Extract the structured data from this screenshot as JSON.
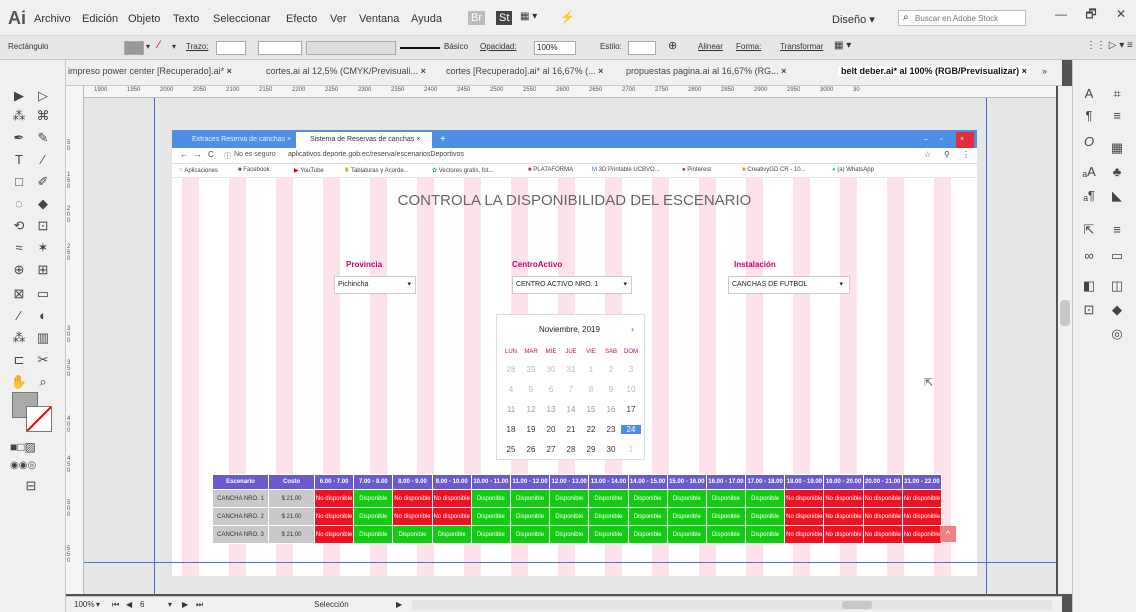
{
  "app": {
    "logo": "Ai"
  },
  "menu": [
    "Archivo",
    "Edición",
    "Objeto",
    "Texto",
    "Seleccionar",
    "Efecto",
    "Ver",
    "Ventana",
    "Ayuda"
  ],
  "menu_badges": [
    "Br",
    "St"
  ],
  "workspace": "Diseño",
  "search_placeholder": "Buscar en Adobe Stock",
  "window_controls": [
    "—",
    "🗗",
    "✕"
  ],
  "control_bar": {
    "object": "Rectángulo",
    "stroke_label": "Trazo:",
    "brush": "Básico",
    "opacity_label": "Opacidad:",
    "opacity": "100%",
    "style_label": "Estilo:",
    "align": "Alinear",
    "shape": "Forma:",
    "transform": "Transformar"
  },
  "doc_tabs": [
    {
      "label": "impreso power center [Recuperado].ai*",
      "close": "×"
    },
    {
      "label": "cortes.ai al 12,5% (CMYK/Previsuali...",
      "close": "×"
    },
    {
      "label": "cortes [Recuperado].ai* al 16,67% (...",
      "close": "×"
    },
    {
      "label": "propuestas pagina.ai al 16,67% (RG...",
      "close": "×"
    },
    {
      "label": "belt deber.ai* al 100% (RGB/Previsualizar)",
      "close": "×"
    }
  ],
  "tabs_more": "»",
  "ruler_top": [
    "1900",
    "1950",
    "2000",
    "2050",
    "2100",
    "2150",
    "2200",
    "2250",
    "2300",
    "2350",
    "2400",
    "2450",
    "2500",
    "2550",
    "2600",
    "2650",
    "2700",
    "2750",
    "2800",
    "2850",
    "2900",
    "2950",
    "3000",
    "30"
  ],
  "ruler_left": [
    "5",
    "0",
    "1",
    "5",
    "0",
    "2",
    "0",
    "0",
    "2",
    "5",
    "0",
    "3",
    "0",
    "0",
    "3",
    "5",
    "0",
    "4",
    "0",
    "0",
    "4",
    "5",
    "0",
    "5",
    "0",
    "0",
    "5",
    "5",
    "0"
  ],
  "status": {
    "zoom": "100%",
    "page": "6",
    "tool": "Selección"
  },
  "browser": {
    "tabs": [
      {
        "label": "Extraces Reserva de canchas",
        "close": "×"
      },
      {
        "label": "Sistema de Reservas de canchas",
        "close": "×"
      }
    ],
    "new_tab": "+",
    "nav": [
      "←",
      "→",
      "C"
    ],
    "secure": "No es seguro",
    "url": "aplicativos.deporte.gob.ec/reserva/escenariosDeportivos",
    "bookmarks": [
      "Aplicaciones",
      "Facebook",
      "YouTube",
      "Tablaturas y Acorde...",
      "Vectores gratis, fot...",
      "PLATAFORMA",
      "3D Printable UCBVO...",
      "Pinterest",
      "CreativyGD CR - 10...",
      "(a) WhatsApp"
    ]
  },
  "page": {
    "title": "CONTROLA LA DISPONIBILIDAD DEL ESCENARIO",
    "filters": [
      {
        "label": "Provincia",
        "value": "Pichincha"
      },
      {
        "label": "CentroActivo",
        "value": "CENTRO ACTIVO NRO. 1"
      },
      {
        "label": "Instalación",
        "value": "CANCHAS DE FUTBOL"
      }
    ],
    "calendar": {
      "month": "Noviembre, 2019",
      "weekdays": [
        "LUN",
        "MAR",
        "MIE",
        "JUE",
        "VIE",
        "SAB",
        "DOM"
      ],
      "weeks": [
        [
          "28",
          "29",
          "30",
          "31",
          "1",
          "2",
          "3"
        ],
        [
          "4",
          "5",
          "6",
          "7",
          "8",
          "9",
          "10"
        ],
        [
          "11",
          "12",
          "13",
          "14",
          "15",
          "16",
          "17"
        ],
        [
          "18",
          "19",
          "20",
          "21",
          "22",
          "23",
          "24"
        ],
        [
          "25",
          "26",
          "27",
          "28",
          "29",
          "30",
          "1"
        ]
      ],
      "selected": "24"
    },
    "table": {
      "headers": [
        "Escenario",
        "Costo",
        "6.00 - 7.00",
        "7.00 - 8.00",
        "8.00 - 9.00",
        "9.00 - 10.00",
        "10.00 - 11.00",
        "11.00 - 12.00",
        "12.00 - 13.00",
        "13.00 - 14.00",
        "14.00 - 15.00",
        "15.00 - 16.00",
        "16.00 - 17.00",
        "17.00 - 18.00",
        "18.00 - 19.00",
        "19.00 - 20.00",
        "20.00 - 21.00",
        "21.00 - 22.00"
      ],
      "rows": [
        {
          "name": "CANCHA NRO. 1",
          "cost": "$ 21,00",
          "status": [
            "No disponible",
            "Disponible",
            "No disponible",
            "No disponible",
            "Disponible",
            "Disponible",
            "Disponible",
            "Disponible",
            "Disponible",
            "Disponible",
            "Disponible",
            "Disponible",
            "No disponible",
            "No disponible",
            "No disponible",
            "No disponible"
          ]
        },
        {
          "name": "CANCHA NRO. 2",
          "cost": "$ 21,00",
          "status": [
            "No disponible",
            "Disponible",
            "No disponible",
            "No disponible",
            "Disponible",
            "Disponible",
            "Disponible",
            "Disponible",
            "Disponible",
            "Disponible",
            "Disponible",
            "Disponible",
            "No disponible",
            "No disponible",
            "No disponible",
            "No disponible"
          ]
        },
        {
          "name": "CANCHA NRO. 3",
          "cost": "$ 21,00",
          "status": [
            "No disponible",
            "Disponible",
            "Disponible",
            "Disponible",
            "Disponible",
            "Disponible",
            "Disponible",
            "Disponible",
            "Disponible",
            "Disponible",
            "Disponible",
            "Disponible",
            "No disponible",
            "No disponible",
            "No disponible",
            "No disponible"
          ]
        }
      ]
    }
  },
  "colors": {
    "available": "#11cc11",
    "unavailable": "#ee1122",
    "header": "#6a5acd",
    "tabstrip": "#4e8fe5",
    "stripe": "#fde2ea"
  }
}
